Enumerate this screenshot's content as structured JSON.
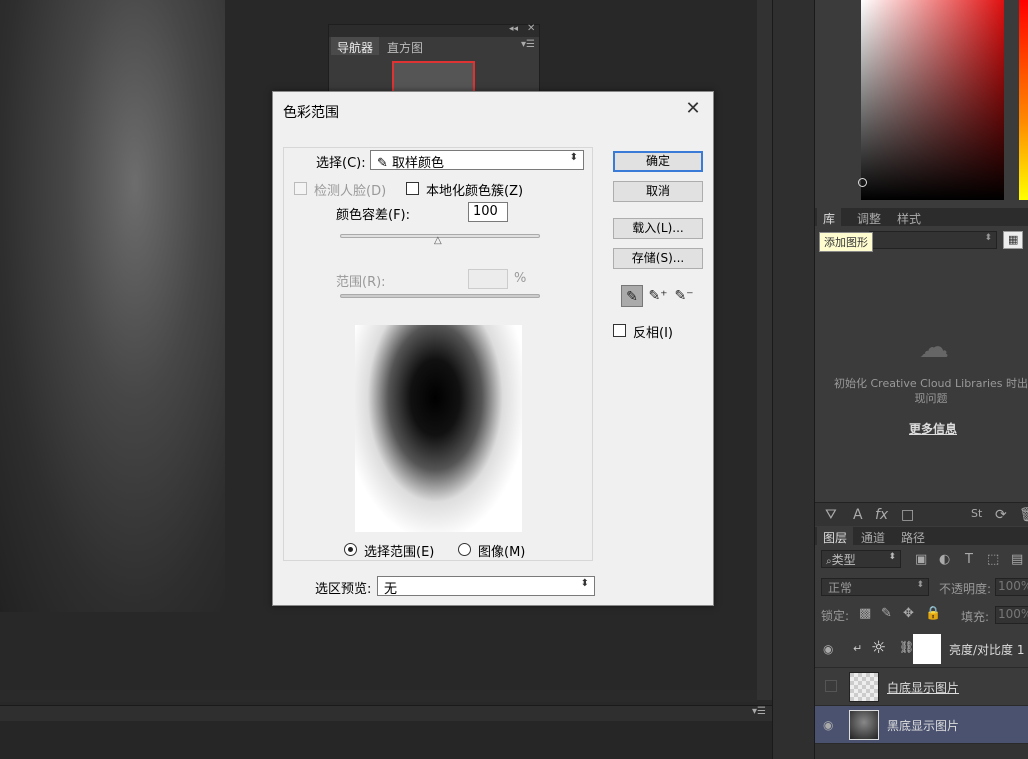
{
  "navigator": {
    "tab_navigator": "导航器",
    "tab_histogram": "直方图"
  },
  "dialog": {
    "title": "色彩范围",
    "select_label": "选择(C):",
    "select_value": "取样颜色",
    "detect_faces_label": "检测人脸(D)",
    "localized_clusters_label": "本地化颜色簇(Z)",
    "fuzziness_label": "颜色容差(F):",
    "fuzziness_value": "100",
    "range_label": "范围(R):",
    "range_unit": "%",
    "selection_radio_label": "选择范围(E)",
    "image_radio_label": "图像(M)",
    "selection_preview_label": "选区预览:",
    "selection_preview_value": "无",
    "ok_label": "确定",
    "cancel_label": "取消",
    "load_label": "载入(L)...",
    "save_label": "存储(S)...",
    "invert_label": "反相(I)"
  },
  "libraries": {
    "tab_libraries": "库",
    "tab_adjustments": "调整",
    "tab_styles": "样式",
    "tooltip": "添加图形",
    "cc_message": "初始化 Creative Cloud Libraries 时出现问题",
    "more_info": "更多信息"
  },
  "layers": {
    "tab_layers": "图层",
    "tab_channels": "通道",
    "tab_paths": "路径",
    "filter_kind": "类型",
    "blend_mode": "正常",
    "opacity_label": "不透明度:",
    "opacity_value": "100%",
    "lock_label": "锁定:",
    "fill_label": "填充:",
    "fill_value": "100%",
    "items": [
      {
        "name": "亮度/对比度 1",
        "visible": true
      },
      {
        "name": "白底显示图片",
        "visible": false
      },
      {
        "name": "黑底显示图片",
        "visible": true,
        "selected": true
      }
    ]
  },
  "colors": {
    "accent": "#3b7bd8",
    "selected_layer": "#4a5270",
    "tooltip_bg": "#fffdd0"
  }
}
